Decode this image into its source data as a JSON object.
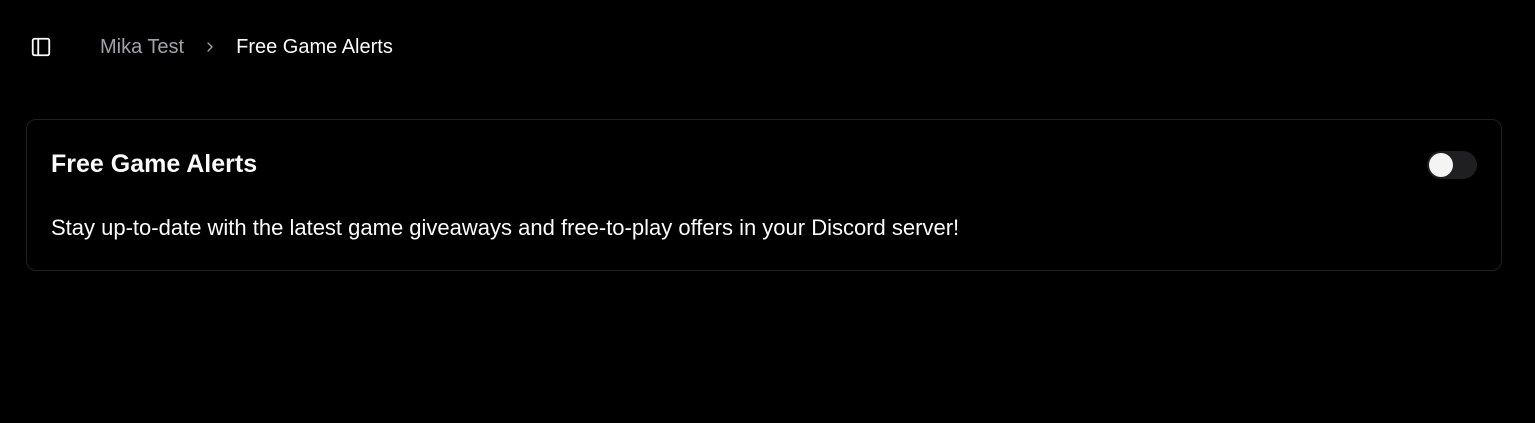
{
  "header": {
    "sidebar_toggle_icon": "panel-left-icon",
    "breadcrumb": {
      "parent": "Mika Test",
      "separator_icon": "chevron-right-icon",
      "current": "Free Game Alerts"
    }
  },
  "card": {
    "title": "Free Game Alerts",
    "description": "Stay up-to-date with the latest game giveaways and free-to-play offers in your Discord server!",
    "toggle": {
      "enabled": false
    }
  },
  "colors": {
    "background": "#000000",
    "text_primary": "#fafafa",
    "text_muted": "#a1a1aa",
    "card_border": "#1f1f22",
    "toggle_track_off": "#1f1f22",
    "toggle_knob": "#f4f4f5"
  }
}
